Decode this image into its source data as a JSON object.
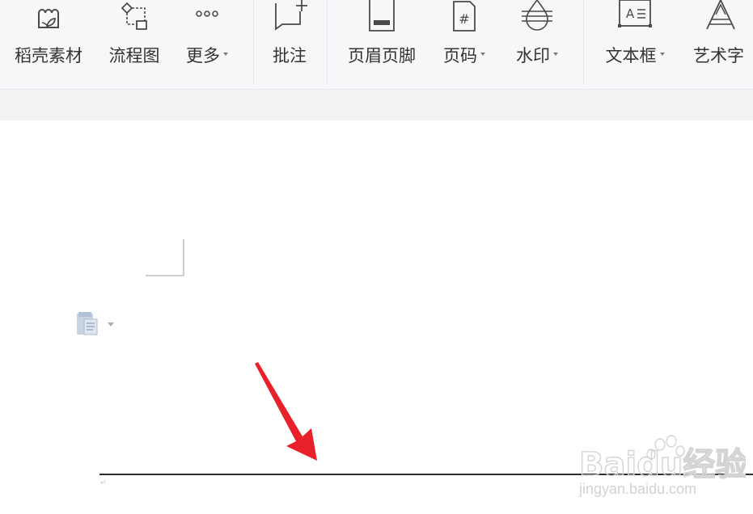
{
  "ribbon": {
    "buttons": [
      {
        "label": "稻壳素材",
        "icon": "doc-shell-material-icon",
        "dropdown": false
      },
      {
        "label": "流程图",
        "icon": "flowchart-icon",
        "dropdown": false
      },
      {
        "label": "更多",
        "icon": "more-dots-icon",
        "dropdown": true
      },
      {
        "label": "批注",
        "icon": "comment-icon",
        "dropdown": false
      },
      {
        "label": "页眉页脚",
        "icon": "header-footer-icon",
        "dropdown": false
      },
      {
        "label": "页码",
        "icon": "page-number-icon",
        "dropdown": true
      },
      {
        "label": "水印",
        "icon": "watermark-icon",
        "dropdown": true
      },
      {
        "label": "文本框",
        "icon": "text-box-icon",
        "dropdown": true
      },
      {
        "label": "艺术字",
        "icon": "word-art-icon",
        "dropdown": false
      }
    ]
  },
  "document": {
    "paste_options_icon": "paste-options-icon",
    "annotation_arrow_color": "#e8202a"
  },
  "watermark": {
    "brand": "Baidu经验",
    "url": "jingyan.baidu.com"
  },
  "colors": {
    "ribbon_bg": "#f6f7f9",
    "label_text": "#333333",
    "arrow": "#e8202a"
  }
}
